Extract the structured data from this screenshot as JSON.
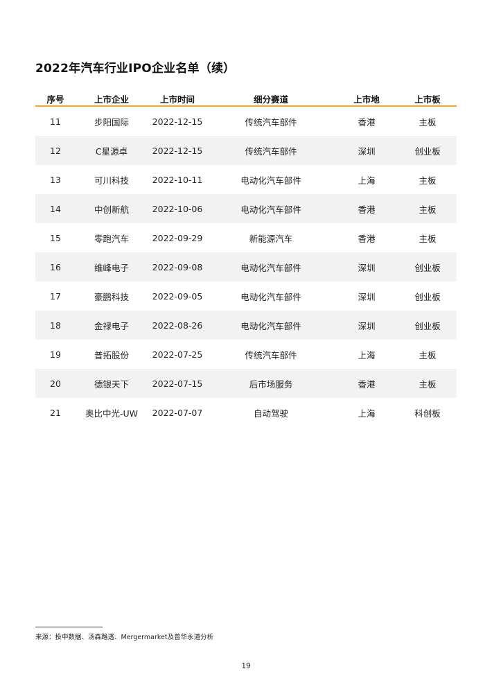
{
  "title": "2022年汽车行业IPO企业名单（续）",
  "table": {
    "headers": [
      "序号",
      "上市企业",
      "上市时间",
      "细分赛道",
      "上市地",
      "上市板"
    ],
    "rows": [
      [
        "11",
        "步阳国际",
        "2022-12-15",
        "传统汽车部件",
        "香港",
        "主板"
      ],
      [
        "12",
        "C星源卓",
        "2022-12-15",
        "传统汽车部件",
        "深圳",
        "创业板"
      ],
      [
        "13",
        "可川科技",
        "2022-10-11",
        "电动化汽车部件",
        "上海",
        "主板"
      ],
      [
        "14",
        "中创新航",
        "2022-10-06",
        "电动化汽车部件",
        "香港",
        "主板"
      ],
      [
        "15",
        "零跑汽车",
        "2022-09-29",
        "新能源汽车",
        "香港",
        "主板"
      ],
      [
        "16",
        "维峰电子",
        "2022-09-08",
        "电动化汽车部件",
        "深圳",
        "创业板"
      ],
      [
        "17",
        "豪鹏科技",
        "2022-09-05",
        "电动化汽车部件",
        "深圳",
        "创业板"
      ],
      [
        "18",
        "金禄电子",
        "2022-08-26",
        "电动化汽车部件",
        "深圳",
        "创业板"
      ],
      [
        "19",
        "普拓股份",
        "2022-07-25",
        "传统汽车部件",
        "上海",
        "主板"
      ],
      [
        "20",
        "德银天下",
        "2022-07-15",
        "后市场服务",
        "香港",
        "主板"
      ],
      [
        "21",
        "奥比中光-UW",
        "2022-07-07",
        "自动驾驶",
        "上海",
        "科创板"
      ]
    ]
  },
  "footnote": "来源：投中数据、汤森路透、Mergermarket及普华永道分析",
  "page_number": "19",
  "colors": {
    "header_rule": "#f5a623",
    "zebra_row": "#f2f2f2"
  }
}
